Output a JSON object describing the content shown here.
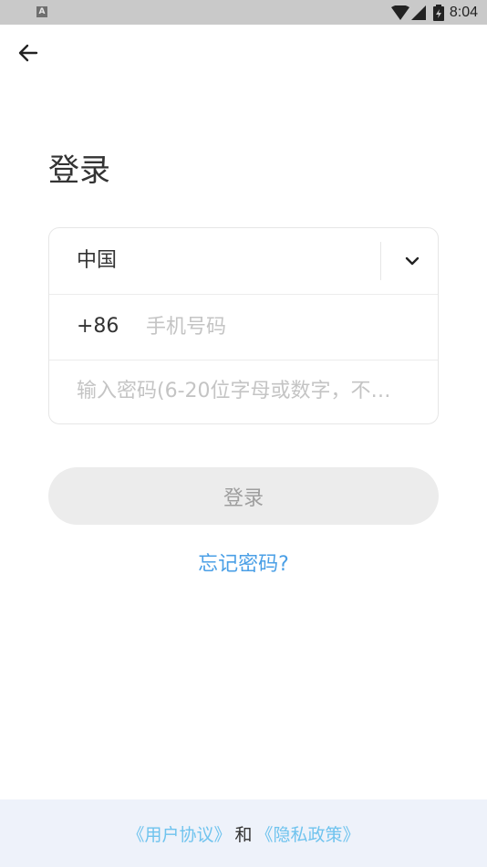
{
  "status_bar": {
    "time": "8:04",
    "notification_icon_letter": "A"
  },
  "header": {
    "back_icon": "arrow-left-icon"
  },
  "title": "登录",
  "form": {
    "country": "中国",
    "dropdown_icon": "chevron-down-icon",
    "dial_code": "+86",
    "phone_placeholder": "手机号码",
    "password_placeholder": "输入密码(6-20位字母或数字，不…"
  },
  "login_button": "登录",
  "forgot_password": "忘记密码?",
  "footer": {
    "user_agreement": "《用户协议》",
    "conjunction": "和",
    "privacy_policy": "《隐私政策》"
  },
  "colors": {
    "link_blue": "#4a9fe6",
    "footer_link": "#6fc3ee",
    "button_disabled_bg": "#ececec",
    "footer_bg": "#eef2fa"
  }
}
